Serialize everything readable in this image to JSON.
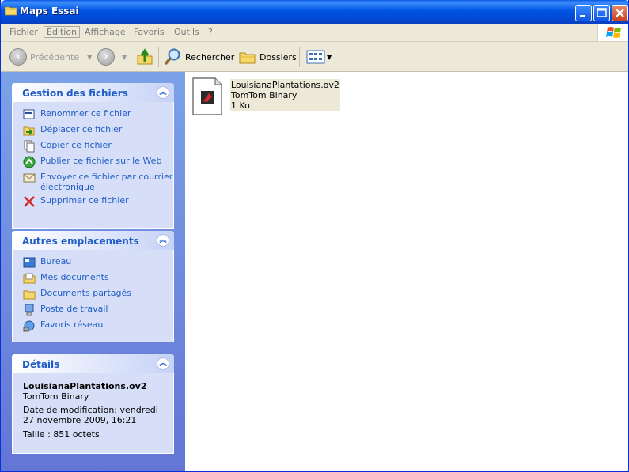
{
  "window": {
    "title": "Maps Essai"
  },
  "menu": {
    "items": [
      "Fichier",
      "Edition",
      "Affichage",
      "Favoris",
      "Outils",
      "?"
    ]
  },
  "toolbar": {
    "back": "Précédente",
    "search": "Rechercher",
    "folders": "Dossiers"
  },
  "file_tasks": {
    "title": "Gestion des fichiers",
    "items": [
      {
        "label": "Renommer ce fichier",
        "icon": "rename-icon"
      },
      {
        "label": "Déplacer ce fichier",
        "icon": "move-icon"
      },
      {
        "label": "Copier ce fichier",
        "icon": "copy-icon"
      },
      {
        "label": "Publier ce fichier sur le Web",
        "icon": "globe-icon"
      },
      {
        "label": "Envoyer ce fichier par courrier électronique",
        "icon": "email-icon"
      },
      {
        "label": "Supprimer ce fichier",
        "icon": "delete-icon"
      }
    ]
  },
  "other_places": {
    "title": "Autres emplacements",
    "items": [
      {
        "label": "Bureau",
        "icon": "desktop-icon"
      },
      {
        "label": "Mes documents",
        "icon": "my-documents-icon"
      },
      {
        "label": "Documents partagés",
        "icon": "shared-folder-icon"
      },
      {
        "label": "Poste de travail",
        "icon": "computer-icon"
      },
      {
        "label": "Favoris réseau",
        "icon": "network-icon"
      }
    ]
  },
  "details": {
    "title": "Détails",
    "name": "LouisianaPlantations.ov2",
    "type": "TomTom Binary",
    "modified": "Date de modification: vendredi 27 novembre 2009, 16:21",
    "size": "Taille : 851 octets"
  },
  "file": {
    "name": "LouisianaPlantations.ov2",
    "type": "TomTom Binary",
    "size": "1 Ko"
  }
}
